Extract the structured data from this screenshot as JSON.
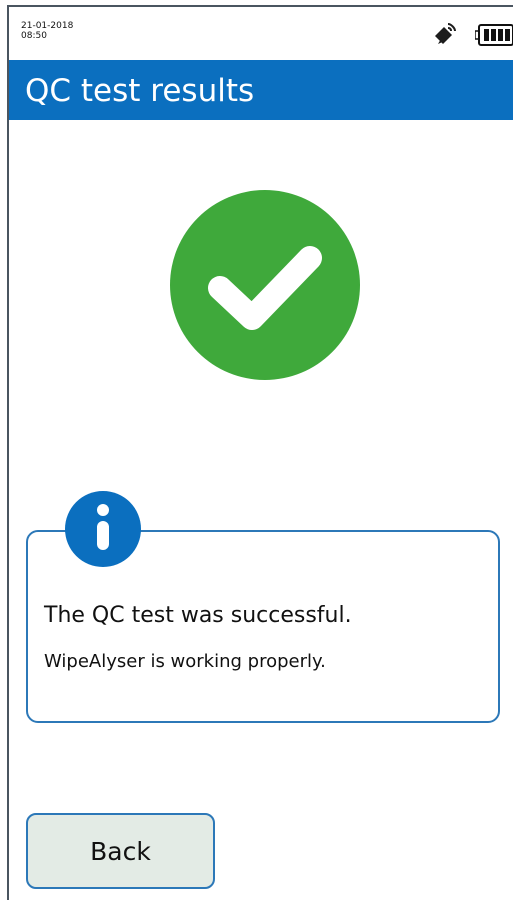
{
  "status_bar": {
    "date": "21-01-2018",
    "time": "08:50",
    "satellite_icon": "satellite-signal-icon",
    "battery_icon": "battery-full-icon"
  },
  "header": {
    "title": "QC test results",
    "background_color": "#0b6fbf"
  },
  "result": {
    "icon": "success-checkmark-icon",
    "icon_color": "#3fa93b"
  },
  "info_card": {
    "icon": "info-icon",
    "icon_color": "#0b6fbf",
    "message": "The QC test was successful.",
    "submessage": "WipeAlyser is working properly."
  },
  "actions": {
    "back_label": "Back"
  }
}
